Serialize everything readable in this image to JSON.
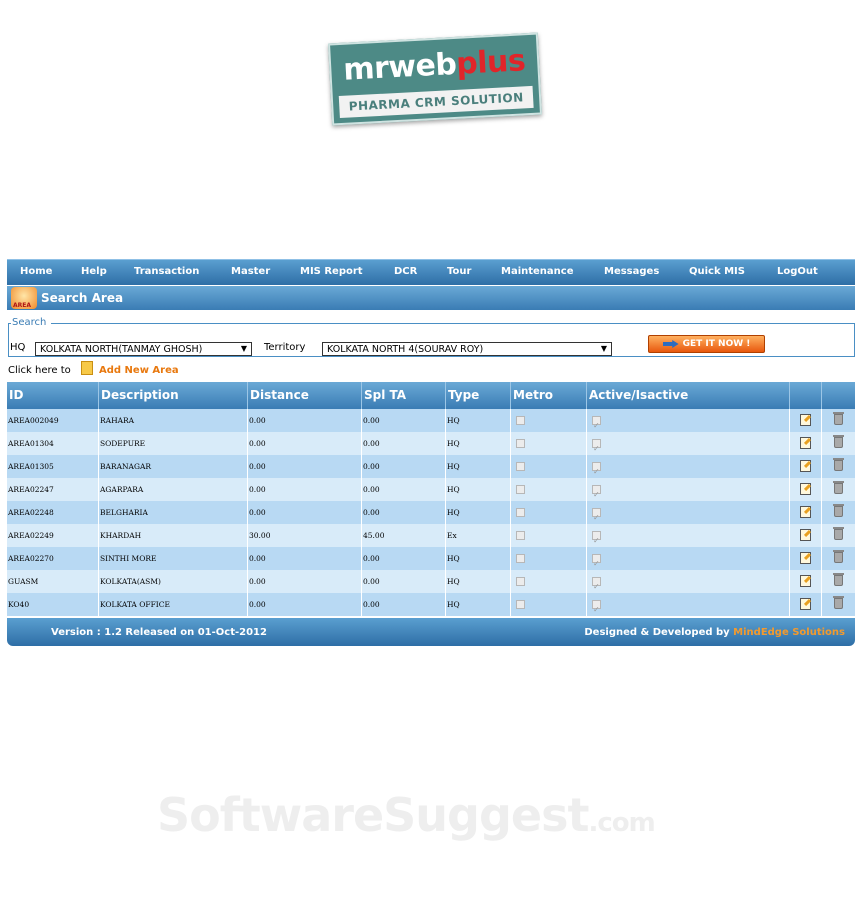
{
  "logo": {
    "word_white": "mrweb",
    "word_red": "plus",
    "tagline": "PHARMA CRM SOLUTION"
  },
  "nav": [
    "Home",
    "Help",
    "Transaction",
    "Master",
    "MIS Report",
    "DCR",
    "Tour",
    "Maintenance",
    "Messages",
    "Quick MIS",
    "LogOut"
  ],
  "page": {
    "icon_label": "AREA",
    "title": "Search Area"
  },
  "search": {
    "legend": "Search",
    "hq_label": "HQ",
    "hq_value": "KOLKATA NORTH(TANMAY GHOSH)",
    "territory_label": "Territory",
    "territory_value": "KOLKATA NORTH 4(SOURAV ROY)",
    "button_label": "GET IT NOW !"
  },
  "add": {
    "prefix": "Click here to",
    "link": "Add New Area"
  },
  "table": {
    "headers": [
      "ID",
      "Description",
      "Distance",
      "Spl TA",
      "Type",
      "Metro",
      "Active/Isactive"
    ],
    "rows": [
      {
        "id": "AREA002049",
        "desc": "RAHARA",
        "distance": "0.00",
        "spl_ta": "0.00",
        "type": "HQ",
        "metro": false,
        "active": true
      },
      {
        "id": "AREA01304",
        "desc": "SODEPURE",
        "distance": "0.00",
        "spl_ta": "0.00",
        "type": "HQ",
        "metro": false,
        "active": true
      },
      {
        "id": "AREA01305",
        "desc": "BARANAGAR",
        "distance": "0.00",
        "spl_ta": "0.00",
        "type": "HQ",
        "metro": false,
        "active": true
      },
      {
        "id": "AREA02247",
        "desc": "AGARPARA",
        "distance": "0.00",
        "spl_ta": "0.00",
        "type": "HQ",
        "metro": false,
        "active": true
      },
      {
        "id": "AREA02248",
        "desc": "BELGHARIA",
        "distance": "0.00",
        "spl_ta": "0.00",
        "type": "HQ",
        "metro": false,
        "active": true
      },
      {
        "id": "AREA02249",
        "desc": "KHARDAH",
        "distance": "30.00",
        "spl_ta": "45.00",
        "type": "Ex",
        "metro": false,
        "active": true
      },
      {
        "id": "AREA02270",
        "desc": "SINTHI MORE",
        "distance": "0.00",
        "spl_ta": "0.00",
        "type": "HQ",
        "metro": false,
        "active": true
      },
      {
        "id": "GUASM",
        "desc": "KOLKATA(ASM)",
        "distance": "0.00",
        "spl_ta": "0.00",
        "type": "HQ",
        "metro": false,
        "active": true
      },
      {
        "id": "KO40",
        "desc": "KOLKATA OFFICE",
        "distance": "0.00",
        "spl_ta": "0.00",
        "type": "HQ",
        "metro": false,
        "active": true
      }
    ]
  },
  "footer": {
    "version": "Version : 1.2 Released on 01-Oct-2012",
    "designed_by": "Designed & Developed by",
    "company": "MindEdge Solutions"
  },
  "watermark": {
    "main": "SoftwareSuggest",
    "suffix": ".com"
  },
  "colors": {
    "nav_blue": "#2e6ea6",
    "row_odd": "#b8d9f3",
    "row_even": "#d8ebf9",
    "accent_orange": "#e8780e"
  }
}
